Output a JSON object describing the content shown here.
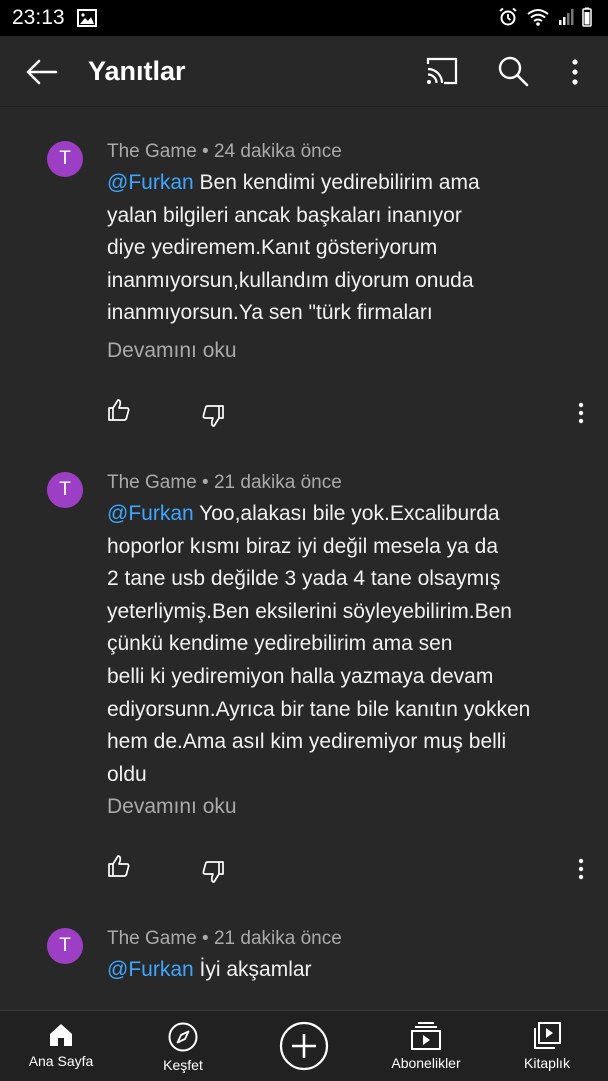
{
  "status_bar": {
    "time": "23:13"
  },
  "app_bar": {
    "title": "Yanıtlar"
  },
  "comments": [
    {
      "avatar_letter": "T",
      "author": "The Game",
      "time": "24 dakika önce",
      "mention": "@Furkan",
      "text": " Ben kendimi yedirebilirim ama\nyalan bilgileri ancak başkaları inanıyor\ndiye yediremem.Kanıt gösteriyorum\ninanmıyorsun,kullandım diyorum onuda\ninanmıyorsun.Ya sen \"türk firmaları",
      "read_more": "Devamını oku"
    },
    {
      "avatar_letter": "T",
      "author": "The Game",
      "time": "21 dakika önce",
      "mention": "@Furkan",
      "text": " Yoo,alakası bile yok.Excaliburda\nhoporlor kısmı biraz iyi değil mesela ya da\n2 tane usb değilde 3 yada 4 tane olsaymış\nyeterliymiş.Ben eksilerini söyleyebilirim.Ben\nçünkü kendime yedirebilirim ama sen\nbelli ki yediremiyon halla yazmaya devam\nediyorsunn.Ayrıca bir tane bile kanıtın yokken\nhem de.Ama asıl kim yediremiyor muş belli\noldu",
      "read_more": "Devamını oku"
    },
    {
      "avatar_letter": "T",
      "author": "The Game",
      "time": "21 dakika önce",
      "mention": "@Furkan",
      "text": " İyi akşamlar"
    }
  ],
  "bottom_nav": {
    "home": "Ana Sayfa",
    "explore": "Keşfet",
    "subscriptions": "Abonelikler",
    "library": "Kitaplık"
  },
  "colors": {
    "background": "#282828",
    "mention": "#3ea6ff",
    "avatar": "#9c3fc4",
    "secondary_text": "#aaaaaa"
  }
}
